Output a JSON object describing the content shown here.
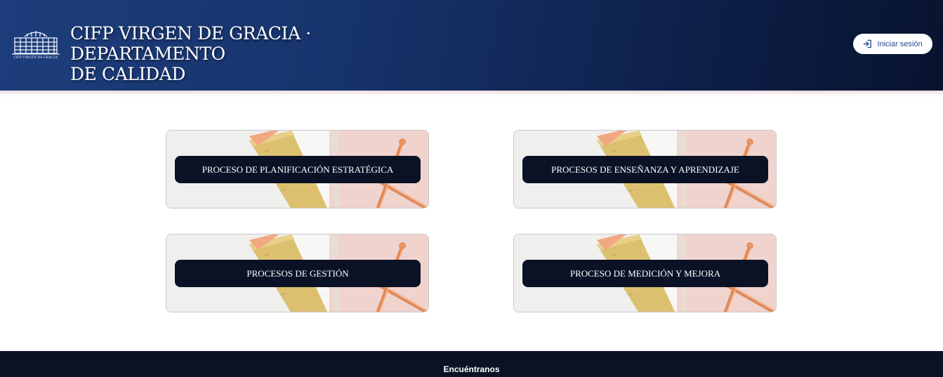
{
  "header": {
    "title_line1": "CIFP VIRGEN DE GRACIA · DEPARTAMENTO",
    "title_line2": "DE CALIDAD",
    "logo_caption": "CIFP VIRGEN DE GRACIA",
    "logo_icon": "building-logo-icon",
    "login_label": "Iniciar sesión",
    "login_icon": "login-icon"
  },
  "cards": [
    {
      "label": "PROCESO DE PLANIFICACIÓN ESTRATÉGICA"
    },
    {
      "label": "PROCESOS DE ENSEÑANZA Y APRENDIZAJE"
    },
    {
      "label": "PROCESOS DE GESTIÓN"
    },
    {
      "label": "PROCESO DE MEDICIÓN Y MEJORA"
    }
  ],
  "footer": {
    "title": "Encuéntranos"
  },
  "colors": {
    "header_dark": "#08132e",
    "header_light": "#1d3d7c",
    "pill_bg": "#0b1226",
    "login_text": "#274a8c"
  }
}
